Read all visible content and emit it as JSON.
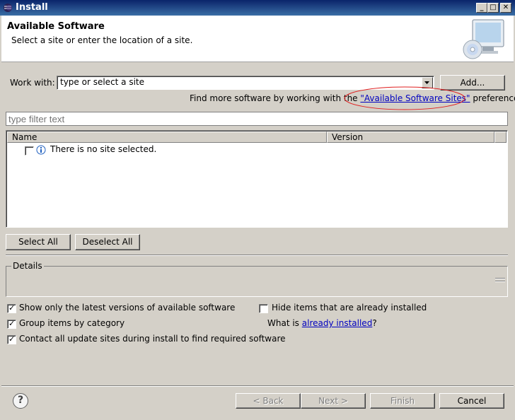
{
  "window": {
    "title": "Install",
    "min_glyph": "_",
    "max_glyph": "□",
    "close_glyph": "✕"
  },
  "header": {
    "title": "Available Software",
    "subtitle": "Select a site or enter the location of a site."
  },
  "work_with": {
    "label": "Work with:",
    "value": "type or select a site",
    "add_label": "Add..."
  },
  "find_more": {
    "prefix": "Find more software by working with the",
    "link": "\"Available Software Sites\"",
    "suffix": "preferences."
  },
  "filter": {
    "placeholder": "type filter text"
  },
  "table": {
    "columns": [
      "Name",
      "Version"
    ],
    "rows": [
      {
        "name": "There is no site selected.",
        "checked": false
      }
    ]
  },
  "buttons": {
    "select_all": "Select All",
    "deselect_all": "Deselect All"
  },
  "details": {
    "label": "Details"
  },
  "options": {
    "show_latest": "Show only the latest versions of available software",
    "group_by_category": "Group items by category",
    "contact_sites": "Contact all update sites during install to find required software",
    "hide_installed": "Hide items that are already installed",
    "what_is_prefix": "What is",
    "what_is_link": "already installed",
    "what_is_suffix": "?",
    "checked_glyph": "✓"
  },
  "footer": {
    "back": "< Back",
    "next": "Next >",
    "finish": "Finish",
    "cancel": "Cancel",
    "help_glyph": "?"
  },
  "colors": {
    "titlebar_start": "#0a246a",
    "titlebar_end": "#3a6ea5",
    "dialog_bg": "#d4d0c8",
    "link": "#0000c0",
    "annotation": "#e02020"
  }
}
